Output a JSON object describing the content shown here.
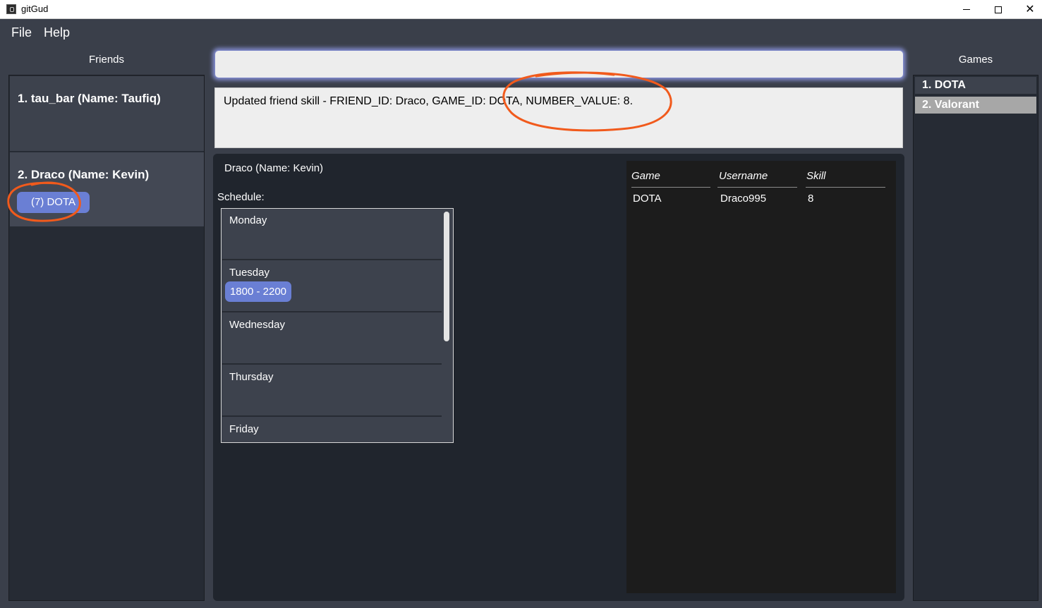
{
  "window": {
    "title": "gitGud",
    "controls": [
      "minimize",
      "maximize",
      "close"
    ]
  },
  "menu": {
    "file": "File",
    "help": "Help"
  },
  "friends": {
    "heading": "Friends",
    "items": [
      {
        "label": "1.  tau_bar (Name: Taufiq)",
        "games": []
      },
      {
        "label": "2.  Draco (Name: Kevin)",
        "games": [
          "(7) DOTA"
        ]
      }
    ]
  },
  "command": {
    "value": "",
    "placeholder": ""
  },
  "result": {
    "message": "Updated friend skill - FRIEND_ID: Draco, GAME_ID: DOTA, NUMBER_VALUE: 8."
  },
  "detail": {
    "name": "Draco (Name: Kevin)",
    "schedule_label": "Schedule:",
    "schedule": [
      {
        "day": "Monday",
        "slots": []
      },
      {
        "day": "Tuesday",
        "slots": [
          "1800 - 2200"
        ]
      },
      {
        "day": "Wednesday",
        "slots": []
      },
      {
        "day": "Thursday",
        "slots": []
      },
      {
        "day": "Friday",
        "slots": []
      }
    ],
    "table": {
      "headers": [
        "Game",
        "Username",
        "Skill"
      ],
      "rows": [
        [
          "DOTA",
          "Draco995",
          "8"
        ]
      ]
    }
  },
  "games": {
    "heading": "Games",
    "items": [
      "1. DOTA",
      "2. Valorant"
    ]
  },
  "colors": {
    "annotation": "#f15a1c",
    "accent": "#6a7fd4",
    "panel": "#3a3f4a"
  }
}
